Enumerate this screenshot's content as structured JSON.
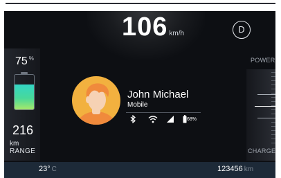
{
  "speed": {
    "value": "106",
    "unit": "km/h"
  },
  "gear": "D",
  "battery": {
    "percent_value": "75",
    "percent_symbol": "%",
    "level": 0.72,
    "range_value": "216",
    "range_unit": "km",
    "range_label": "RANGE"
  },
  "power_meter": {
    "top_label": "POWER",
    "bottom_label": "CHARGE"
  },
  "contact": {
    "name": "John Michael",
    "subtitle": "Mobile",
    "phone_battery": "68%"
  },
  "status_icons": [
    "bluetooth-icon",
    "wifi-icon",
    "signal-icon",
    "phone-battery-icon"
  ],
  "footer": {
    "temperature_value": "23°",
    "temperature_unit": "C",
    "odometer_value": "123456",
    "odometer_unit": "km"
  },
  "colors": {
    "background": "#0d0f13",
    "avatar": "#f2b13f",
    "battery_fill_top": "#33d6c5",
    "battery_fill_bottom": "#a6e86a",
    "footer": "#1d2a38"
  }
}
